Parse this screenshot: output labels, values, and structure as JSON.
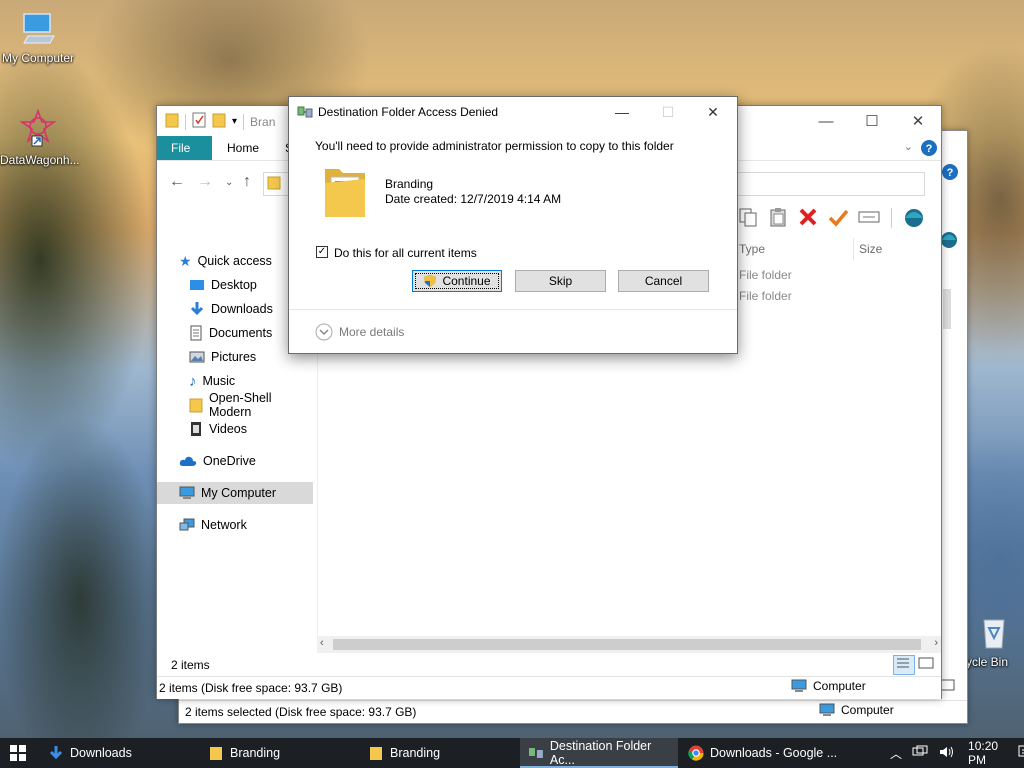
{
  "desktop": {
    "icons": [
      {
        "label": "My Computer",
        "icon": "monitor-icon"
      },
      {
        "label": "DataWagonh...",
        "icon": "app-shortcut-icon"
      },
      {
        "label": "ycle Bin",
        "icon": "recycle-bin-icon"
      }
    ]
  },
  "back_window": {
    "status_items": "2 items selected (Disk free space: 93.7 GB)",
    "status_location": "Computer"
  },
  "explorer": {
    "title_partial": "Bran",
    "tabs": [
      "File",
      "Home",
      "S"
    ],
    "sidebar": [
      {
        "label": "Quick access",
        "icon": "star-icon"
      },
      {
        "label": "Desktop",
        "icon": "desktop-folder-icon"
      },
      {
        "label": "Downloads",
        "icon": "download-arrow-icon"
      },
      {
        "label": "Documents",
        "icon": "documents-icon"
      },
      {
        "label": "Pictures",
        "icon": "pictures-icon"
      },
      {
        "label": "Music",
        "icon": "music-note-icon"
      },
      {
        "label": "Open-Shell Modern",
        "icon": "folder-icon"
      },
      {
        "label": "Videos",
        "icon": "video-icon"
      },
      {
        "label": "OneDrive",
        "icon": "cloud-icon"
      },
      {
        "label": "My Computer",
        "icon": "monitor-icon"
      },
      {
        "label": "Network",
        "icon": "network-icon"
      }
    ],
    "columns": {
      "type": "Type",
      "size": "Size"
    },
    "rows": [
      {
        "type": "File folder"
      },
      {
        "type": "File folder"
      }
    ],
    "item_count": "2 items",
    "status_items": "2 items (Disk free space: 93.7 GB)",
    "status_location": "Computer"
  },
  "dialog": {
    "title": "Destination Folder Access Denied",
    "message": "You'll need to provide administrator permission to copy to this folder",
    "folder_name": "Branding",
    "date_created": "Date created: 12/7/2019 4:14 AM",
    "checkbox_label": "Do this for all current items",
    "checkbox_checked": true,
    "continue_label": "Continue",
    "skip_label": "Skip",
    "cancel_label": "Cancel",
    "more_details": "More details"
  },
  "taskbar": {
    "items": [
      {
        "label": "Downloads",
        "icon": "download-arrow-icon"
      },
      {
        "label": "Branding",
        "icon": "folder-icon"
      },
      {
        "label": "Branding",
        "icon": "folder-icon"
      },
      {
        "label": "Destination Folder Ac...",
        "icon": "copy-dialog-icon"
      },
      {
        "label": "Downloads - Google ...",
        "icon": "chrome-icon"
      }
    ],
    "clock": "10:20 PM"
  },
  "colors": {
    "ribbon_file_tab": "#1b8f9e",
    "taskbar_bg": "#1c2025",
    "folder_yellow": "#f3c84d",
    "delete_red": "#e02020",
    "check_orange": "#e87a1e"
  }
}
